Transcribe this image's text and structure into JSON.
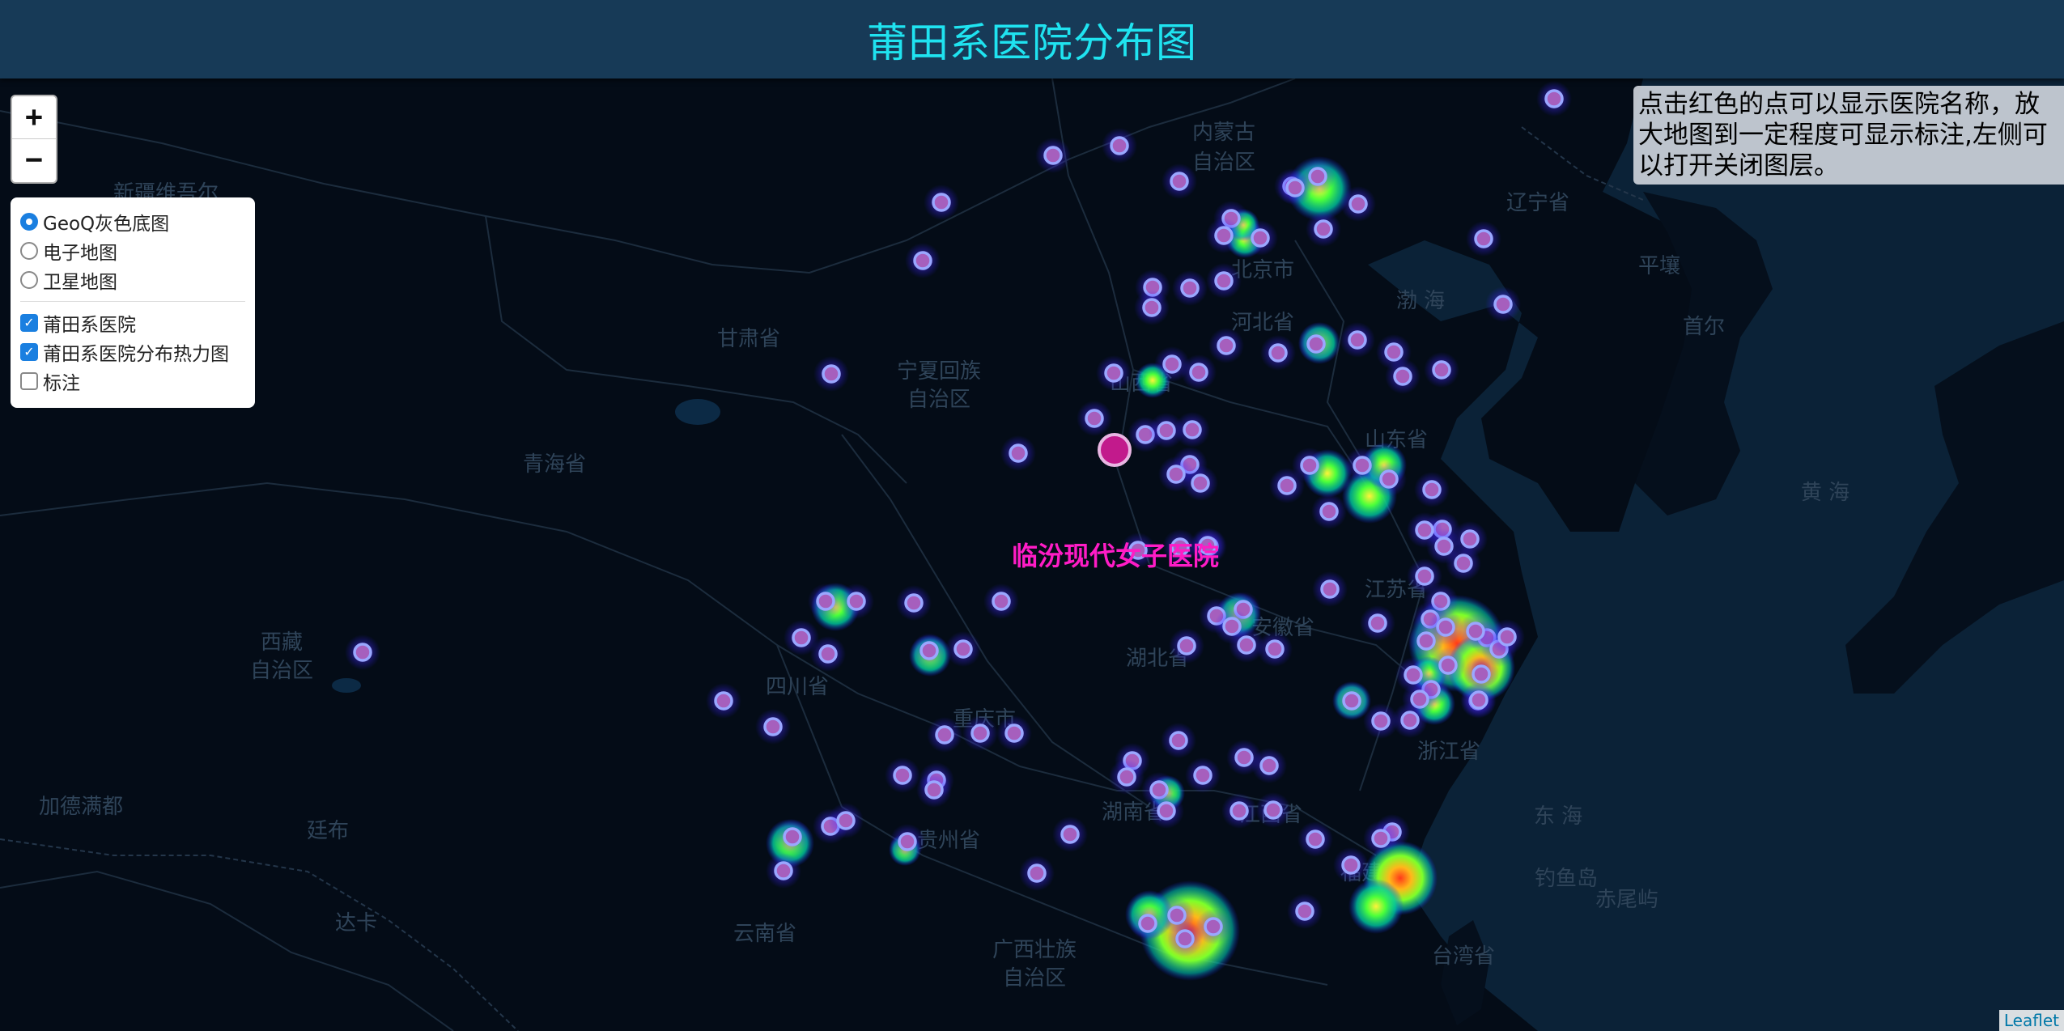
{
  "header": {
    "title": "莆田系医院分布图"
  },
  "zoom": {
    "in_label": "+",
    "out_label": "−"
  },
  "layers": {
    "base": [
      {
        "label": "GeoQ灰色底图",
        "selected": true
      },
      {
        "label": "电子地图",
        "selected": false
      },
      {
        "label": "卫星地图",
        "selected": false
      }
    ],
    "overlays": [
      {
        "label": "莆田系医院",
        "checked": true
      },
      {
        "label": "莆田系医院分布热力图",
        "checked": true
      },
      {
        "label": "标注",
        "checked": false
      }
    ]
  },
  "info": {
    "text": "点击红色的点可以显示医院名称，放大地图到一定程度可显示标注,左侧可以打开关闭图层。"
  },
  "popup": {
    "label": "临汾现代女子医院"
  },
  "attribution": {
    "text": "Leaflet"
  },
  "colors": {
    "header_bg": "#173a57",
    "title": "#1fe3f0",
    "popup": "#ff1cc6",
    "marker_fill": "#a65fbd",
    "marker_ring": "#9aa7ff"
  },
  "map_labels": [
    {
      "text": "内蒙古"
    },
    {
      "text": "自治区"
    },
    {
      "text": "辽宁省"
    },
    {
      "text": "北京市"
    },
    {
      "text": "河北省"
    },
    {
      "text": "甘肃省"
    },
    {
      "text": "宁夏回族"
    },
    {
      "text": "自治区"
    },
    {
      "text": "山西省"
    },
    {
      "text": "山东省"
    },
    {
      "text": "青海省"
    },
    {
      "text": "西藏"
    },
    {
      "text": "自治区"
    },
    {
      "text": "四川省"
    },
    {
      "text": "重庆市"
    },
    {
      "text": "湖北省"
    },
    {
      "text": "安徽省"
    },
    {
      "text": "江苏省"
    },
    {
      "text": "浙江省"
    },
    {
      "text": "湖南省"
    },
    {
      "text": "江西省"
    },
    {
      "text": "贵州省"
    },
    {
      "text": "福建省"
    },
    {
      "text": "云南省"
    },
    {
      "text": "广西壮族"
    },
    {
      "text": "自治区"
    },
    {
      "text": "台湾省"
    },
    {
      "text": "加德满都"
    },
    {
      "text": "廷布"
    },
    {
      "text": "达卡"
    },
    {
      "text": "平壤"
    },
    {
      "text": "首尔"
    },
    {
      "text": "渤 海"
    },
    {
      "text": "黄 海"
    },
    {
      "text": "东 海"
    },
    {
      "text": "钓鱼岛"
    },
    {
      "text": "赤尾屿"
    },
    {
      "text": "新疆维吾尔"
    }
  ]
}
